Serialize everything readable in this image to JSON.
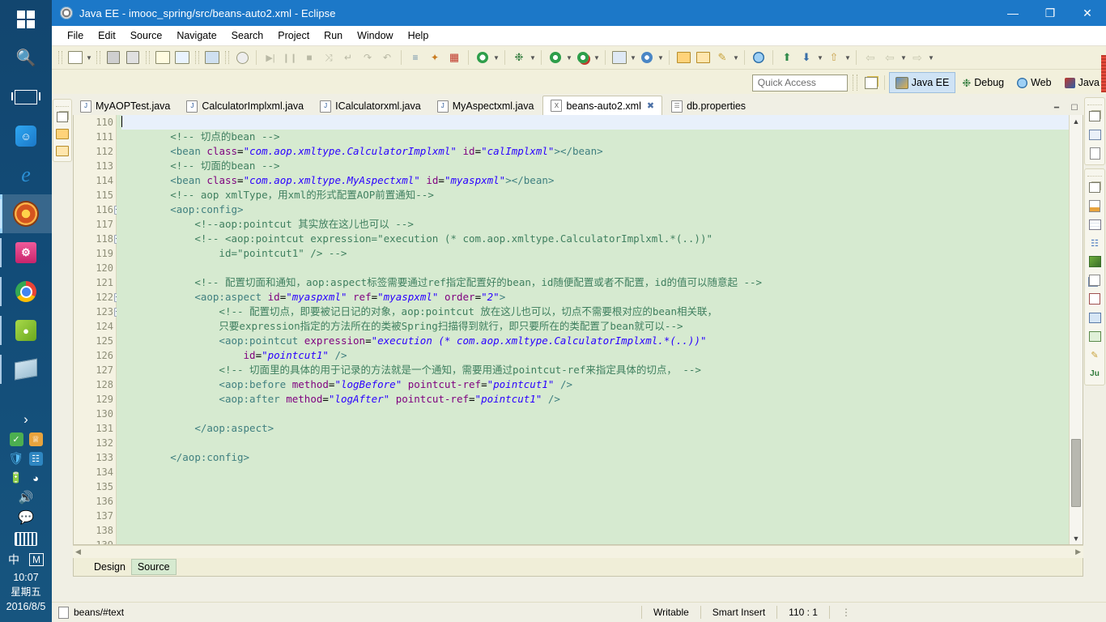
{
  "window": {
    "title": "Java EE - imooc_spring/src/beans-auto2.xml - Eclipse",
    "app_icon": "eclipse-icon",
    "minimize": "—",
    "maximize": "❐",
    "close": "✕"
  },
  "menubar": {
    "items": [
      "File",
      "Edit",
      "Source",
      "Navigate",
      "Search",
      "Project",
      "Run",
      "Window",
      "Help"
    ]
  },
  "quick_access": {
    "placeholder": "Quick Access",
    "value": "Quick Access"
  },
  "perspectives": {
    "open_perspective_icon": "open-perspective-icon",
    "items": [
      {
        "label": "Java EE",
        "icon": "java-ee-perspective-icon",
        "selected": true
      },
      {
        "label": "Debug",
        "icon": "debug-perspective-icon",
        "selected": false
      },
      {
        "label": "Web",
        "icon": "web-perspective-icon",
        "selected": false
      },
      {
        "label": "Java",
        "icon": "java-perspective-icon",
        "selected": false
      }
    ]
  },
  "editor_tabs": [
    {
      "label": "MyAOPTest.java",
      "icon": "java-file-icon",
      "selected": false,
      "closable": false
    },
    {
      "label": "CalculatorImplxml.java",
      "icon": "java-file-icon",
      "selected": false,
      "closable": false
    },
    {
      "label": "ICalculatorxml.java",
      "icon": "java-file-icon",
      "selected": false,
      "closable": false
    },
    {
      "label": "MyAspectxml.java",
      "icon": "java-file-icon",
      "selected": false,
      "closable": false
    },
    {
      "label": "beans-auto2.xml",
      "icon": "xml-file-icon",
      "selected": true,
      "closable": true,
      "close_glyph": "✖"
    },
    {
      "label": "db.properties",
      "icon": "properties-file-icon",
      "selected": false,
      "closable": false
    }
  ],
  "editor": {
    "first_line": 110,
    "cursor_line": 110,
    "lines": [
      {
        "n": 110,
        "fold": false,
        "current": true,
        "text": ""
      },
      {
        "n": 111,
        "fold": false,
        "text": "        <!-- 切点的bean -->"
      },
      {
        "n": 112,
        "fold": false,
        "text": "        <bean class=\"com.aop.xmltype.CalculatorImplxml\" id=\"calImplxml\"></bean>"
      },
      {
        "n": 113,
        "fold": false,
        "text": "        <!-- 切面的bean -->"
      },
      {
        "n": 114,
        "fold": false,
        "text": "        <bean class=\"com.aop.xmltype.MyAspectxml\" id=\"myaspxml\"></bean>"
      },
      {
        "n": 115,
        "fold": false,
        "text": "        <!-- aop xmlType，用xml的形式配置AOP前置通知-->"
      },
      {
        "n": 116,
        "fold": true,
        "text": "        <aop:config>"
      },
      {
        "n": 117,
        "fold": false,
        "text": "            <!--aop:pointcut 其实放在这儿也可以 -->"
      },
      {
        "n": 118,
        "fold": true,
        "text": "            <!-- <aop:pointcut expression=\"execution (* com.aop.xmltype.CalculatorImplxml.*(..))\""
      },
      {
        "n": 119,
        "fold": false,
        "text": "                id=\"pointcut1\" /> -->"
      },
      {
        "n": 120,
        "fold": false,
        "text": ""
      },
      {
        "n": 121,
        "fold": false,
        "text": "            <!-- 配置切面和通知，aop:aspect标签需要通过ref指定配置好的bean，id随便配置或者不配置，id的值可以随意起 -->"
      },
      {
        "n": 122,
        "fold": true,
        "text": "            <aop:aspect id=\"myaspxml\" ref=\"myaspxml\" order=\"2\">"
      },
      {
        "n": 123,
        "fold": true,
        "text": "                <!-- 配置切点，即要被记日记的对象，aop:pointcut 放在这儿也可以，切点不需要根对应的bean相关联，"
      },
      {
        "n": 124,
        "fold": false,
        "text": "                只要expression指定的方法所在的类被Spring扫描得到就行，即只要所在的类配置了bean就可以-->"
      },
      {
        "n": 125,
        "fold": false,
        "text": "                <aop:pointcut expression=\"execution (* com.aop.xmltype.CalculatorImplxml.*(..))\""
      },
      {
        "n": 126,
        "fold": false,
        "text": "                    id=\"pointcut1\" />"
      },
      {
        "n": 127,
        "fold": false,
        "text": "                <!-- 切面里的具体的用于记录的方法就是一个通知，需要用通过pointcut-ref来指定具体的切点， -->"
      },
      {
        "n": 128,
        "fold": false,
        "text": "                <aop:before method=\"logBefore\" pointcut-ref=\"pointcut1\" />"
      },
      {
        "n": 129,
        "fold": false,
        "text": "                <aop:after method=\"logAfter\" pointcut-ref=\"pointcut1\" />"
      },
      {
        "n": 130,
        "fold": false,
        "text": ""
      },
      {
        "n": 131,
        "fold": false,
        "text": "            </aop:aspect>"
      },
      {
        "n": 132,
        "fold": false,
        "text": ""
      },
      {
        "n": 133,
        "fold": false,
        "text": "        </aop:config>"
      },
      {
        "n": 134,
        "fold": false,
        "text": ""
      },
      {
        "n": 135,
        "fold": false,
        "text": ""
      },
      {
        "n": 136,
        "fold": false,
        "text": ""
      },
      {
        "n": 137,
        "fold": false,
        "text": ""
      },
      {
        "n": 138,
        "fold": false,
        "text": ""
      },
      {
        "n": 139,
        "fold": false,
        "text": ""
      }
    ]
  },
  "design_source_tabs": [
    {
      "label": "Design",
      "selected": false
    },
    {
      "label": "Source",
      "selected": true
    }
  ],
  "statusbar": {
    "file": "beans/#text",
    "writable": "Writable",
    "insert_mode": "Smart Insert",
    "position": "110 : 1",
    "dots": "⋮"
  },
  "left_rail": {
    "icons": [
      "restore-view-icon",
      "project-explorer-icon",
      "package-explorer-icon"
    ]
  },
  "right_rail": {
    "group1": [
      "restore-view-icon",
      "outline-icon",
      "properties-icon"
    ],
    "group2": [
      "restore-view-icon",
      "servers-icon",
      "data-source-explorer-icon",
      "snippets-icon",
      "markers-icon",
      "problems-icon",
      "console-icon",
      "progress-icon",
      "search-icon",
      "junit-icon"
    ]
  },
  "taskbar": {
    "top_items": [
      {
        "name": "start-button",
        "icon": "windows-logo-icon",
        "label": ""
      },
      {
        "name": "search-button",
        "icon": "search-icon",
        "label": ""
      },
      {
        "name": "task-view-button",
        "icon": "task-view-icon",
        "label": ""
      },
      {
        "name": "app-qq",
        "icon": "qq-icon",
        "label": "Q"
      },
      {
        "name": "app-edge",
        "icon": "edge-icon",
        "label": "e"
      },
      {
        "name": "app-eclipse",
        "icon": "eclipse-icon",
        "label": "",
        "active": true
      },
      {
        "name": "app-database",
        "icon": "database-icon",
        "label": ""
      },
      {
        "name": "app-chrome",
        "icon": "chrome-icon",
        "label": ""
      },
      {
        "name": "app-evernote",
        "icon": "evernote-icon",
        "label": ""
      },
      {
        "name": "app-notepad",
        "icon": "notepad-icon",
        "label": ""
      }
    ],
    "tray": {
      "expand": "›",
      "row1": [
        "green-shield-icon",
        "antivirus-icon"
      ],
      "row2": [
        "blue-shield-icon",
        "network-tool-icon"
      ],
      "row3": [
        "battery-icon",
        "wifi-icon"
      ],
      "row4": [
        "volume-icon"
      ],
      "row5": [
        "notification-icon"
      ],
      "row6": [
        "keyboard-icon"
      ],
      "ime": {
        "lang": "中",
        "mode": "M"
      },
      "clock": {
        "time": "10:07",
        "weekday": "星期五",
        "date": "2016/8/5"
      }
    }
  },
  "colors": {
    "title_bar": "#1c78c8",
    "toolbar_bg": "#f2f0dc",
    "editor_bg": "#d6ead0",
    "current_line": "#e8f0fb",
    "gutter": "#f4f2e2",
    "comment": "#3f7f5f",
    "tag": "#3f7f7f",
    "attribute": "#7f007f",
    "string": "#2a00ff"
  }
}
